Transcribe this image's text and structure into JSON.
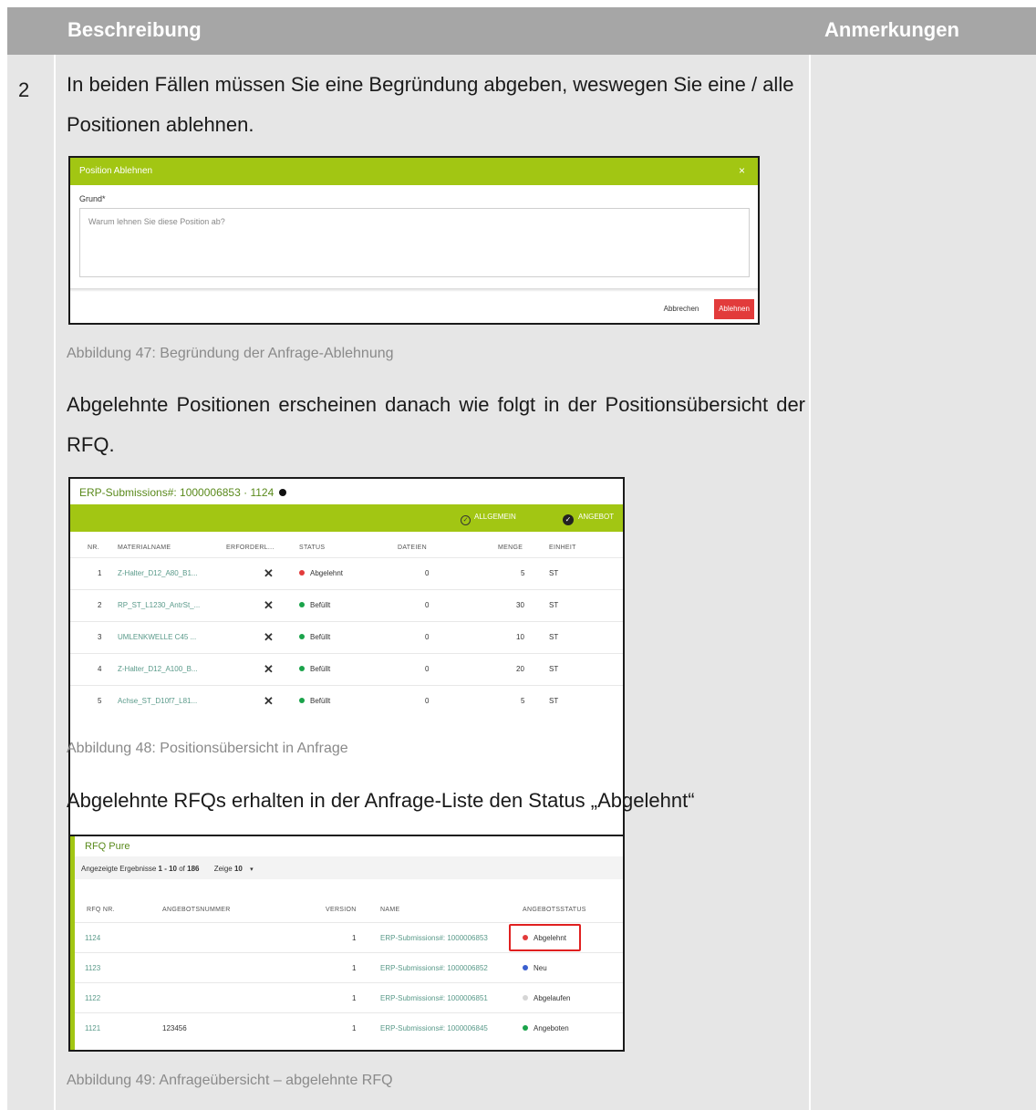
{
  "header": {
    "col_description": "Beschreibung",
    "col_notes": "Anmerkungen"
  },
  "row": {
    "number": "2",
    "para1": "In beiden Fällen müssen Sie eine Begründung abgeben, weswegen Sie eine / alle Positionen ablehnen.",
    "para2": "Abgelehnte Positionen erscheinen danach wie folgt in der Positionsübersicht der RFQ.",
    "para3": "Abgelehnte RFQs erhalten in der Anfrage-Liste den Status „Abgelehnt“"
  },
  "fig47": {
    "caption": "Abbildung 47: Begründung der Anfrage-Ablehnung",
    "dialog_title": "Position Ablehnen",
    "close": "×",
    "field_label": "Grund*",
    "placeholder": "Warum lehnen Sie diese Position ab?",
    "cancel": "Abbrechen",
    "reject": "Ablehnen",
    "accent": "#a2c613",
    "reject_color": "#e23b3b"
  },
  "fig48": {
    "caption": "Abbildung 48: Positionsübersicht in Anfrage",
    "title": "ERP-Submissions#: 1000006853 · 1124",
    "tab_general": "ALLGEMEIN",
    "tab_offer": "ANGEBOT",
    "columns": [
      "NR.",
      "MATERIALNAME",
      "ERFORDERL...",
      "STATUS",
      "DATEIEN",
      "MENGE",
      "EINHEIT"
    ],
    "rows": [
      {
        "nr": "1",
        "material": "Z-Halter_D12_A80_B1...",
        "req": "✕",
        "status": "Abgelehnt",
        "status_color": "#e23b3b",
        "files": "0",
        "qty": "5",
        "unit": "ST"
      },
      {
        "nr": "2",
        "material": "RP_ST_L1230_AntrSt_...",
        "req": "✕",
        "status": "Befüllt",
        "status_color": "#1aa34a",
        "files": "0",
        "qty": "30",
        "unit": "ST"
      },
      {
        "nr": "3",
        "material": "UMLENKWELLE C45 ...",
        "req": "✕",
        "status": "Befüllt",
        "status_color": "#1aa34a",
        "files": "0",
        "qty": "10",
        "unit": "ST"
      },
      {
        "nr": "4",
        "material": "Z-Halter_D12_A100_B...",
        "req": "✕",
        "status": "Befüllt",
        "status_color": "#1aa34a",
        "files": "0",
        "qty": "20",
        "unit": "ST"
      },
      {
        "nr": "5",
        "material": "Achse_ST_D10f7_L81...",
        "req": "✕",
        "status": "Befüllt",
        "status_color": "#1aa34a",
        "files": "0",
        "qty": "5",
        "unit": "ST"
      }
    ]
  },
  "fig49": {
    "caption": "Abbildung 49: Anfrageübersicht – abgelehnte RFQ",
    "title": "RFQ Pure",
    "results_prefix": "Angezeigte Ergebnisse",
    "results_range": "1 - 10",
    "results_of": "of",
    "results_total": "186",
    "show_label": "Zeige",
    "show_value": "10",
    "columns": [
      "RFQ NR.",
      "ANGEBOTSNUMMER",
      "VERSION",
      "NAME",
      "ANGEBOTSSTATUS"
    ],
    "rows": [
      {
        "rfq": "1124",
        "offer": "",
        "version": "1",
        "name": "ERP-Submissions#: 1000006853",
        "status": "Abgelehnt",
        "status_color": "#e23b3b"
      },
      {
        "rfq": "1123",
        "offer": "",
        "version": "1",
        "name": "ERP-Submissions#: 1000006852",
        "status": "Neu",
        "status_color": "#3a5fcf"
      },
      {
        "rfq": "1122",
        "offer": "",
        "version": "1",
        "name": "ERP-Submissions#: 1000006851",
        "status": "Abgelaufen",
        "status_color": "#d6d6d6"
      },
      {
        "rfq": "1121",
        "offer": "123456",
        "version": "1",
        "name": "ERP-Submissions#: 1000006845",
        "status": "Angeboten",
        "status_color": "#1aa34a"
      }
    ]
  }
}
